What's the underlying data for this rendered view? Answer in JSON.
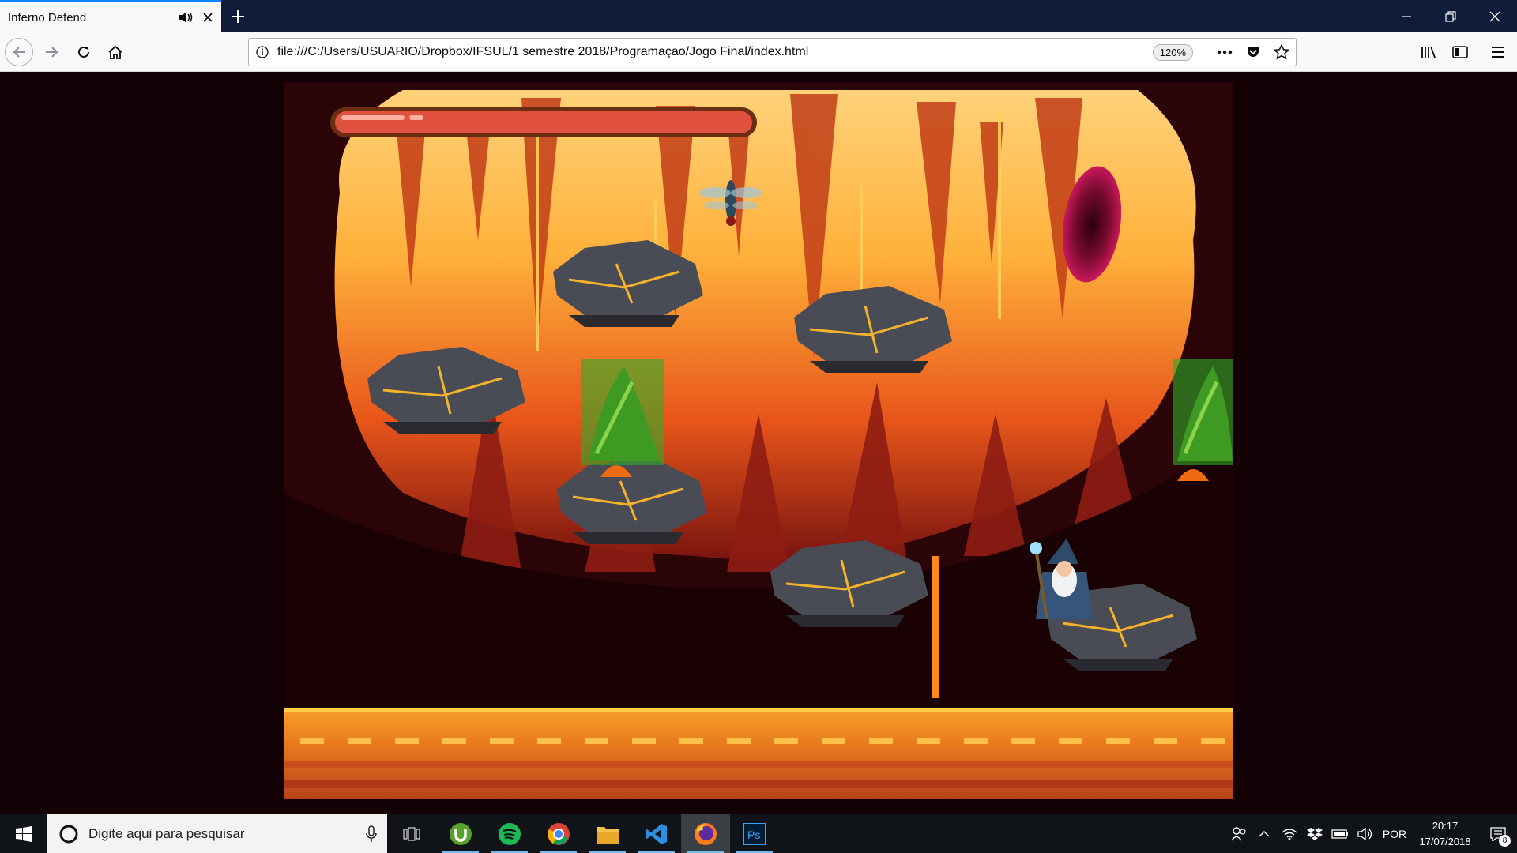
{
  "browser": {
    "tab_title": "Inferno Defend",
    "url": "file:///C:/Users/USUARIO/Dropbox/IFSUL/1 semestre 2018/Programaçao/Jogo Final/index.html",
    "zoom": "120%"
  },
  "game": {
    "health_fraction": 1.0
  },
  "taskbar": {
    "search_placeholder": "Digite aqui para pesquisar",
    "language": "POR",
    "time": "20:17",
    "date": "17/07/2018",
    "notification_count": "8"
  },
  "colors": {
    "tab_accent": "#0a84ff",
    "health_bar": "#e0513f",
    "lava_orange": "#f08a22",
    "portal": "#a0103e"
  }
}
